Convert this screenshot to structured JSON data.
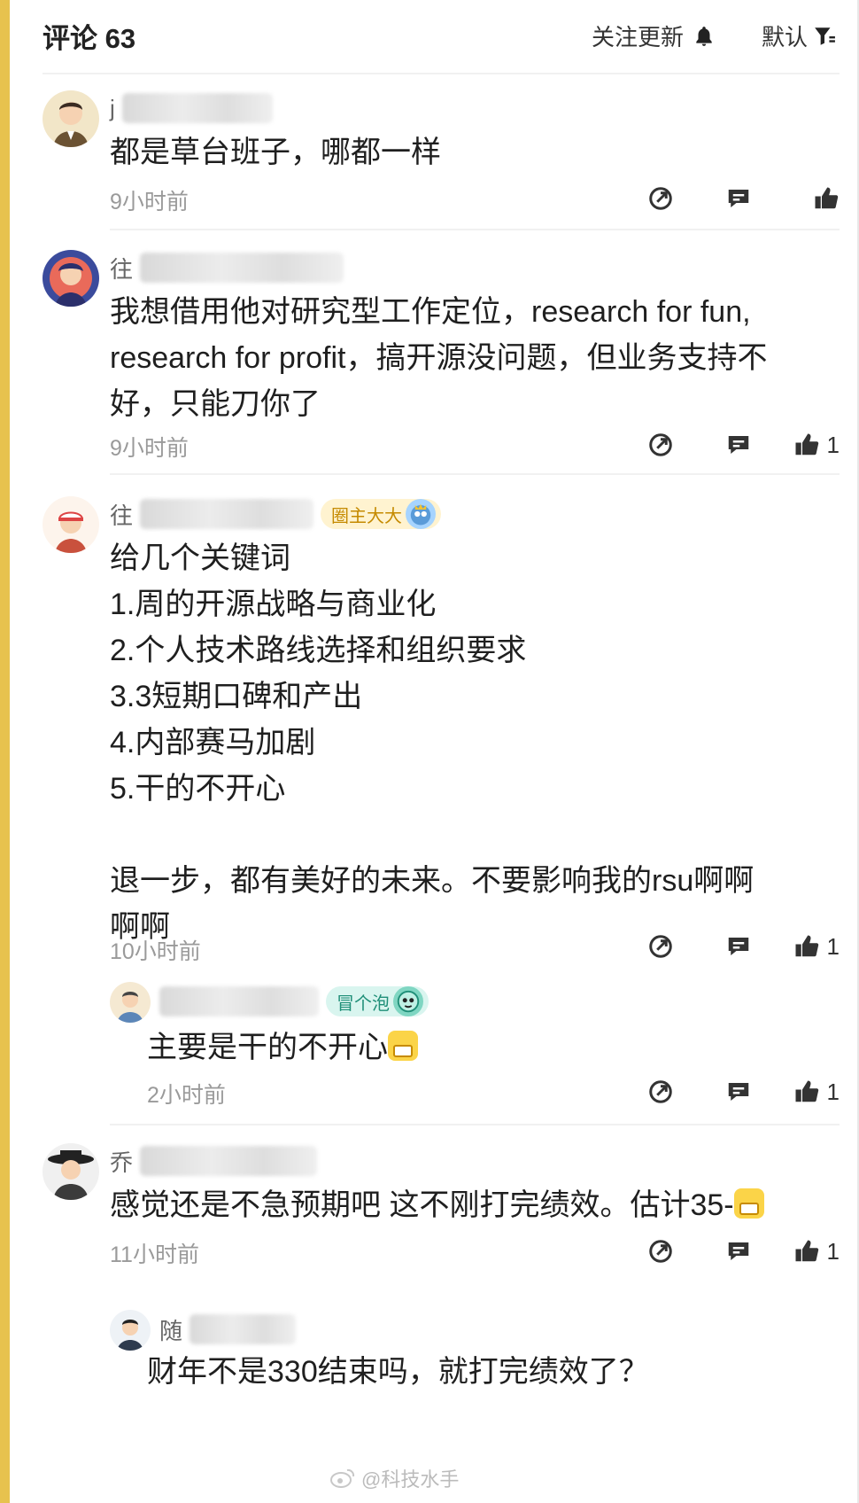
{
  "header": {
    "title": "评论 63",
    "follow_label": "关注更新",
    "sort_label": "默认"
  },
  "comments": [
    {
      "initial": "j",
      "text": "都是草台班子，哪都一样",
      "time": "9小时前",
      "likes": ""
    },
    {
      "initial": "往",
      "text": "我想借用他对研究型工作定位，research for fun,\nresearch for profit，搞开源没问题，但业务支持不\n好，只能刀你了",
      "time": "9小时前",
      "likes": "1"
    },
    {
      "initial": "往",
      "badge": "圈主大大",
      "text": "给几个关键词\n1.周的开源战略与商业化\n2.个人技术路线选择和组织要求\n3.3短期口碑和产出\n4.内部赛马加剧\n5.干的不开心\n\n退一步，都有美好的未来。不要影响我的rsu啊啊\n啊啊",
      "time": "10小时前",
      "likes": "1"
    },
    {
      "badge": "冒个泡",
      "text": "主要是干的不开心",
      "time": "2小时前",
      "likes": "1"
    },
    {
      "initial": "乔",
      "text": "感觉还是不急预期吧 这不刚打完绩效。估计35-",
      "time": "11小时前",
      "likes": "1"
    },
    {
      "initial": "随",
      "text": "财年不是330结束吗，就打完绩效了？"
    }
  ],
  "watermark": "@科技水手",
  "colors": {
    "accent_bar": "#e7c24e",
    "muted_text": "#9a9a9a"
  }
}
